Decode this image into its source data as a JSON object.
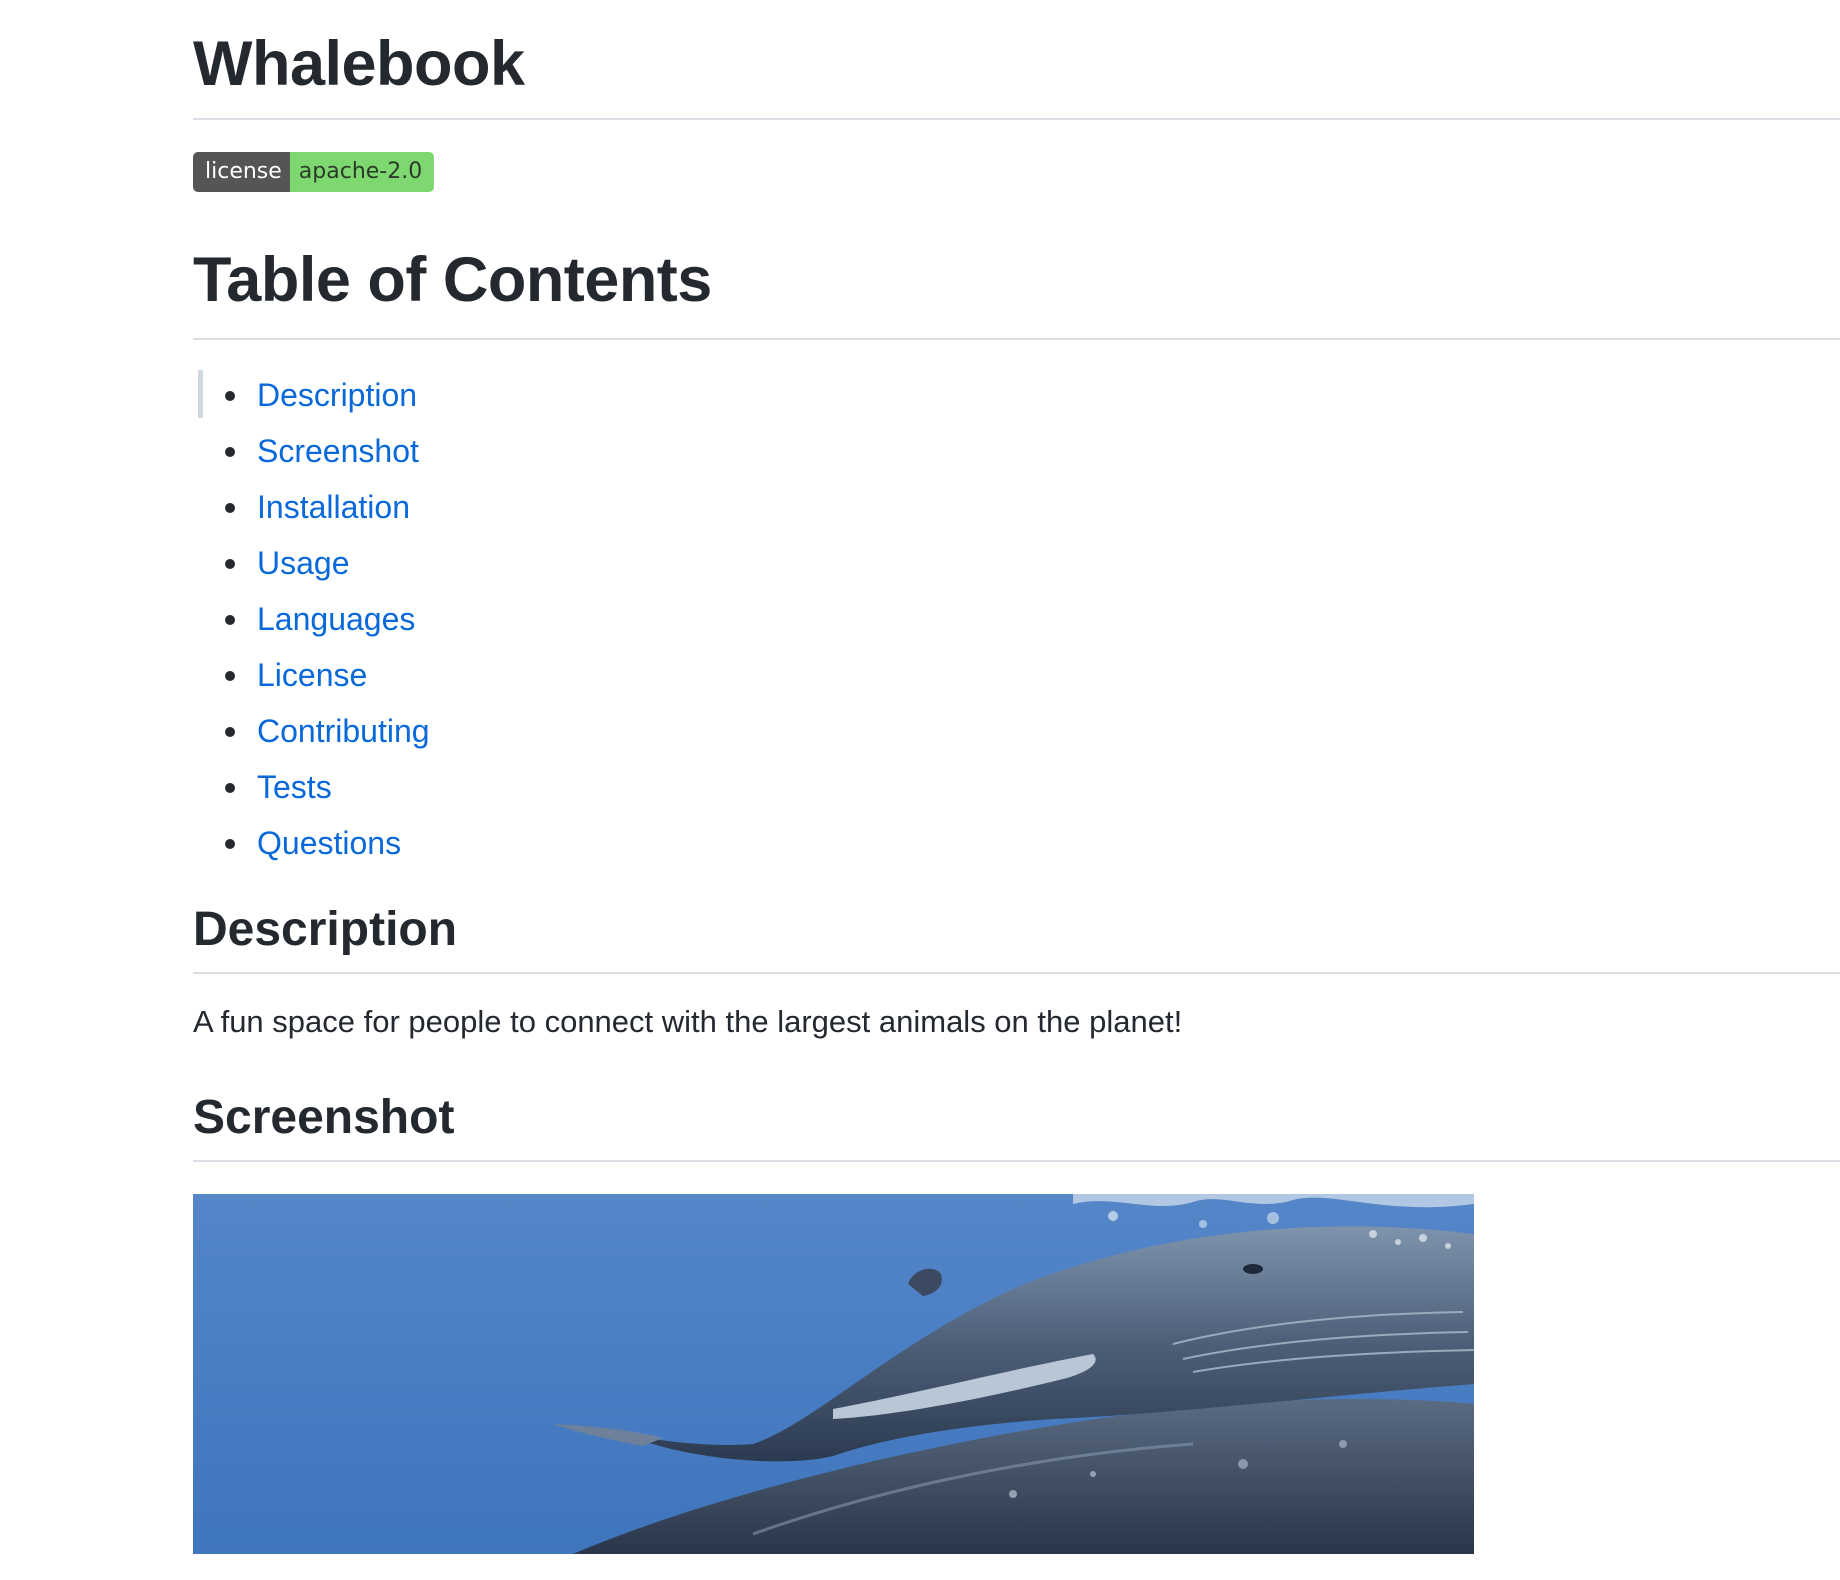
{
  "readme": {
    "title": "Whalebook",
    "badge": {
      "label": "license",
      "value": "apache-2.0"
    },
    "toc": {
      "heading": "Table of Contents",
      "items": [
        {
          "label": "Description"
        },
        {
          "label": "Screenshot"
        },
        {
          "label": "Installation"
        },
        {
          "label": "Usage"
        },
        {
          "label": "Languages"
        },
        {
          "label": "License"
        },
        {
          "label": "Contributing"
        },
        {
          "label": "Tests"
        },
        {
          "label": "Questions"
        }
      ]
    },
    "description": {
      "heading": "Description",
      "text": "A fun space for people to connect with the largest animals on the planet!"
    },
    "screenshot": {
      "heading": "Screenshot",
      "image_icon": "whale-photo"
    }
  },
  "colors": {
    "link": "#0969da",
    "text": "#24292f",
    "badge_left": "#555555",
    "badge_right": "#7ed870",
    "ocean": "#4d80c4"
  }
}
